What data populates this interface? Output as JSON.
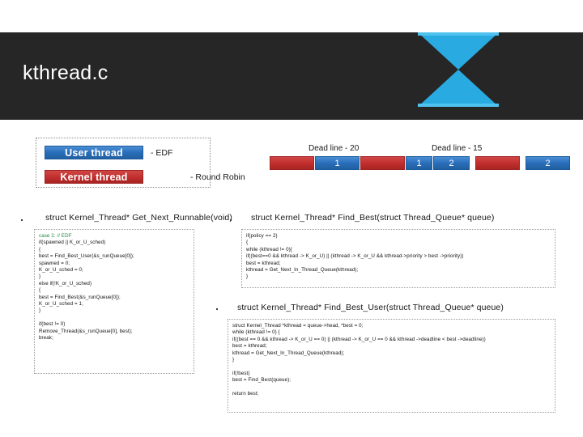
{
  "slide": {
    "title": "kthread.c",
    "header_bg": "#262626",
    "accent": "#29abe2"
  },
  "legend": {
    "user_thread": "User thread",
    "kernel_thread": "Kernel thread",
    "user_note": "- EDF",
    "kernel_note": "- Round Robin",
    "user_color": "#2a6ebb",
    "kernel_color": "#c2302f"
  },
  "timeline": {
    "labels": [
      {
        "text": "Dead line - 20"
      },
      {
        "text": "Dead line - 15"
      }
    ],
    "blocks": [
      {
        "label": "",
        "kind": "red"
      },
      {
        "label": "1",
        "kind": "blue"
      },
      {
        "label": "",
        "kind": "red"
      },
      {
        "label": "1",
        "kind": "blue"
      },
      {
        "label": "2",
        "kind": "blue"
      },
      {
        "label": "",
        "kind": "red"
      },
      {
        "label": "2",
        "kind": "blue"
      }
    ]
  },
  "sections": [
    {
      "caption": "struct Kernel_Thread* Get_Next_Runnable(void)",
      "code": [
        {
          "text": "case 2: // EDF",
          "comment": true
        },
        {
          "text": "if(spawned || K_or_U_sched)"
        },
        {
          "text": "{"
        },
        {
          "text": "best = Find_Best_User(&s_runQueue[0]);"
        },
        {
          "text": "spawned = 0;"
        },
        {
          "text": "K_or_U_sched = 0;"
        },
        {
          "text": "}"
        },
        {
          "text": "else if(!K_or_U_sched)"
        },
        {
          "text": "{"
        },
        {
          "text": "best = Find_Best(&s_runQueue[0]);"
        },
        {
          "text": "K_or_U_sched = 1;"
        },
        {
          "text": "}"
        },
        {
          "text": "",
          "blank": true
        },
        {
          "text": "if(best != 0)"
        },
        {
          "text": "Remove_Thread(&s_runQueue[0], best);"
        },
        {
          "text": "break;"
        }
      ]
    },
    {
      "caption": "struct Kernel_Thread* Find_Best(struct Thread_Queue* queue)",
      "code": [
        {
          "text": "if(policy == 2)"
        },
        {
          "text": "{"
        },
        {
          "text": "while (kthread != 0){"
        },
        {
          "text": "if((best==0 && kthread -> K_or_U) || (kthread -> K_or_U && kthread->priority > best ->priority))"
        },
        {
          "text": "best = kthread;"
        },
        {
          "text": "kthread = Get_Next_In_Thread_Queue(kthread);"
        },
        {
          "text": "}"
        }
      ]
    },
    {
      "caption": "struct Kernel_Thread* Find_Best_User(struct Thread_Queue* queue)",
      "code": [
        {
          "text": "struct Kernel_Thread *kthread = queue->head, *best = 0;"
        },
        {
          "text": "while (kthread != 0) {"
        },
        {
          "text": "if((best == 0 && kthread -> K_or_U == 0) || (kthread -> K_or_U == 0 && kthread ->deadline < best ->deadline))"
        },
        {
          "text": "best = kthread;"
        },
        {
          "text": "kthread = Get_Next_In_Thread_Queue(kthread);"
        },
        {
          "text": "}"
        },
        {
          "text": "",
          "blank": true
        },
        {
          "text": "if(!best)"
        },
        {
          "text": "best = Find_Best(queue);"
        },
        {
          "text": "",
          "blank": true
        },
        {
          "text": "return best;"
        }
      ]
    }
  ]
}
